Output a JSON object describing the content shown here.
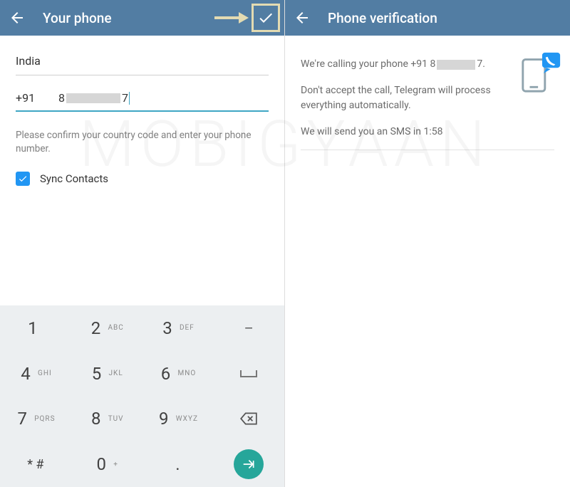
{
  "watermark": "MOBIGYAAN",
  "left": {
    "title": "Your phone",
    "country": "India",
    "country_code": "+91",
    "phone_display_prefix": "8",
    "phone_display_suffix": "7",
    "hint": "Please confirm your country code and enter your phone number.",
    "sync_label": "Sync Contacts",
    "sync_checked": true
  },
  "right": {
    "title": "Phone verification",
    "line1_prefix": "We're calling your phone +91 8",
    "line1_suffix": "7.",
    "line2": "Don't accept the call, Telegram will process everything automatically.",
    "line3": "We will send you an SMS in 1:58"
  },
  "keypad": {
    "keys": [
      {
        "d": "1",
        "l": ""
      },
      {
        "d": "2",
        "l": "ABC"
      },
      {
        "d": "3",
        "l": "DEF"
      },
      {
        "sym": "minus"
      },
      {
        "d": "4",
        "l": "GHI"
      },
      {
        "d": "5",
        "l": "JKL"
      },
      {
        "d": "6",
        "l": "MNO"
      },
      {
        "sym": "space"
      },
      {
        "d": "7",
        "l": "PQRS"
      },
      {
        "d": "8",
        "l": "TUV"
      },
      {
        "d": "9",
        "l": "WXYZ"
      },
      {
        "sym": "backspace"
      },
      {
        "d": "* #",
        "l": ""
      },
      {
        "d": "0",
        "l": "+"
      },
      {
        "d": ".",
        "l": ""
      },
      {
        "sym": "enter"
      }
    ]
  }
}
